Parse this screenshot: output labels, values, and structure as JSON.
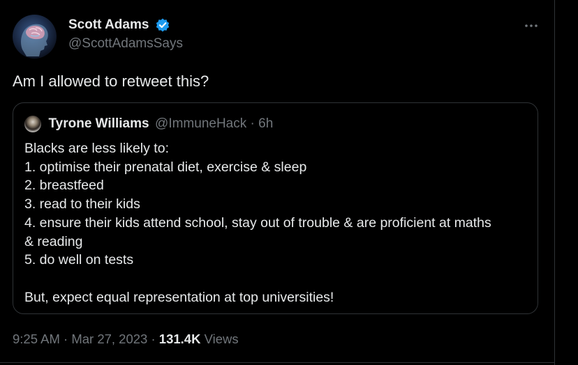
{
  "tweet": {
    "author": {
      "display_name": "Scott Adams",
      "handle": "@ScottAdamsSays",
      "verified": true,
      "avatar_icon": "brain-head-avatar"
    },
    "text": "Am I allowed to retweet this?",
    "more_icon": "more-options-icon",
    "quoted": {
      "display_name": "Tyrone Williams",
      "handle_time": "@ImmuneHack · 6h",
      "lines": [
        "Blacks are less likely to:",
        "1. optimise their prenatal diet, exercise & sleep",
        "2. breastfeed",
        "3. read to their kids",
        "4. ensure their kids attend school, stay out of trouble & are proficient at maths",
        "& reading",
        "5. do well on tests",
        "",
        "But, expect equal representation at top universities!"
      ]
    },
    "meta": {
      "time_date": "9:25 AM · Mar 27, 2023 · ",
      "views_count": "131.4K",
      "views_label": " Views"
    }
  },
  "colors": {
    "background": "#000000",
    "text_primary": "#e7e9ea",
    "text_secondary": "#71767b",
    "border": "#2f3336",
    "verified_blue": "#1d9bf0"
  }
}
